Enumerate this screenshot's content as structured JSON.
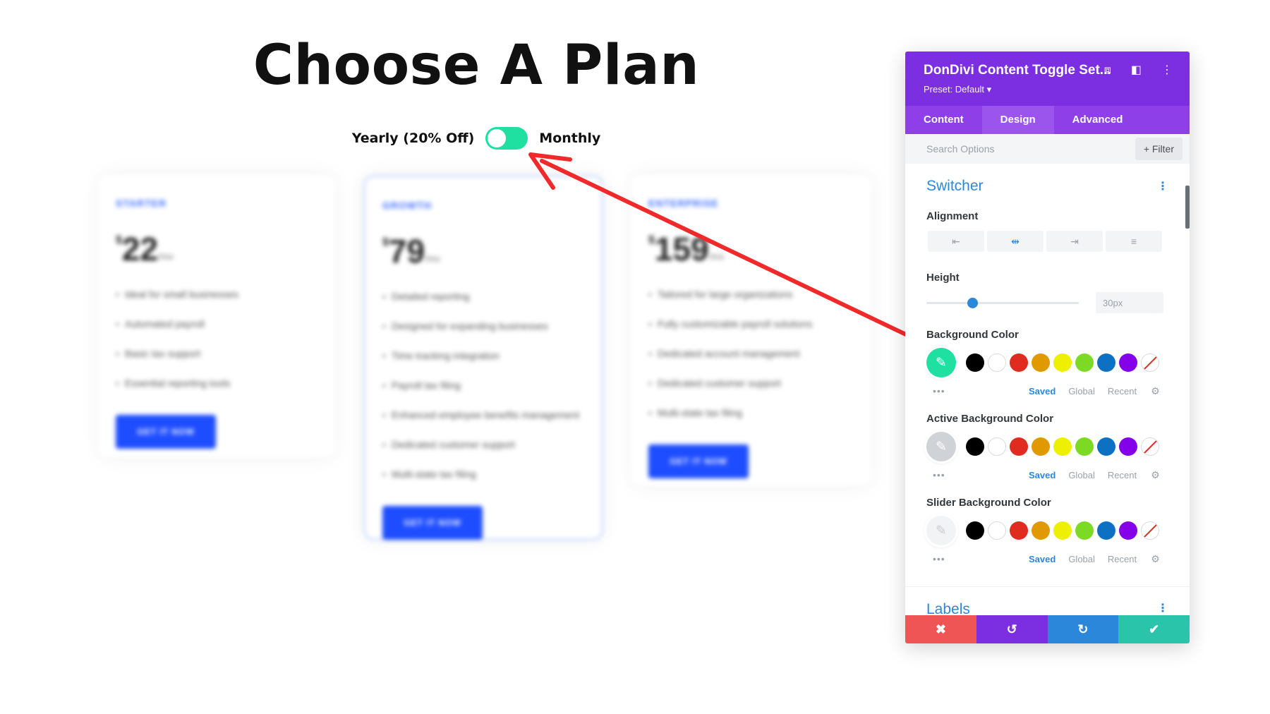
{
  "page": {
    "title": "Choose A Plan",
    "toggle_left": "Yearly (20% Off)",
    "toggle_right": "Monthly"
  },
  "cards": [
    {
      "plan": "STARTER",
      "currency": "$",
      "amount": "22",
      "period": "/mo",
      "features": [
        "Ideal for small businesses",
        "Automated payroll",
        "Basic tax support",
        "Essential reporting tools"
      ],
      "cta": "GET IT NOW"
    },
    {
      "plan": "GROWTH",
      "currency": "$",
      "amount": "79",
      "period": "/mo",
      "features": [
        "Detailed reporting",
        "Designed for expanding businesses",
        "Time tracking integration",
        "Payroll tax filing",
        "Enhanced employee benefits management",
        "Dedicated customer support",
        "Multi-state tax filing"
      ],
      "cta": "GET IT NOW"
    },
    {
      "plan": "ENTERPRISE",
      "currency": "$",
      "amount": "159",
      "period": "/mo",
      "features": [
        "Tailored for large organizations",
        "Fully customizable payroll solutions",
        "Dedicated account management",
        "Dedicated customer support",
        "Multi-state tax filing"
      ],
      "cta": "GET IT NOW"
    }
  ],
  "panel": {
    "title": "DonDivi Content Toggle Set...",
    "preset": "Preset: Default ▾",
    "tabs": [
      "Content",
      "Design",
      "Advanced"
    ],
    "active_tab": "Design",
    "search_placeholder": "Search Options",
    "filter_label": "+ Filter",
    "section": "Switcher",
    "alignment_label": "Alignment",
    "height_label": "Height",
    "height_value": "30px",
    "height_slider_fraction": 0.3,
    "color_fields": [
      {
        "label": "Background Color",
        "picker_color": "#1fe0a0"
      },
      {
        "label": "Active Background Color",
        "picker_color": "#cfd2d6"
      },
      {
        "label": "Slider Background Color",
        "picker_color": "#f2f3f5"
      }
    ],
    "palette": [
      "#000000",
      "#ffffff",
      "#e02b20",
      "#e09900",
      "#edf000",
      "#7cda24",
      "#0c71c3",
      "#8300e9",
      "none"
    ],
    "palette_tabs": [
      "Saved",
      "Global",
      "Recent"
    ],
    "active_palette_tab": "Saved",
    "next_section": "Labels"
  },
  "colors": {
    "panel_header": "#7b2fe0",
    "accent_blue": "#2b87da",
    "switch_on": "#1fe0a0",
    "arrow": "#f02a2a",
    "cta": "#1e4dff"
  },
  "icons": {
    "header": [
      "focus-icon",
      "split-view-icon",
      "kebab-menu-icon"
    ],
    "footer": [
      "close-icon",
      "undo-icon",
      "redo-icon",
      "check-icon"
    ]
  }
}
